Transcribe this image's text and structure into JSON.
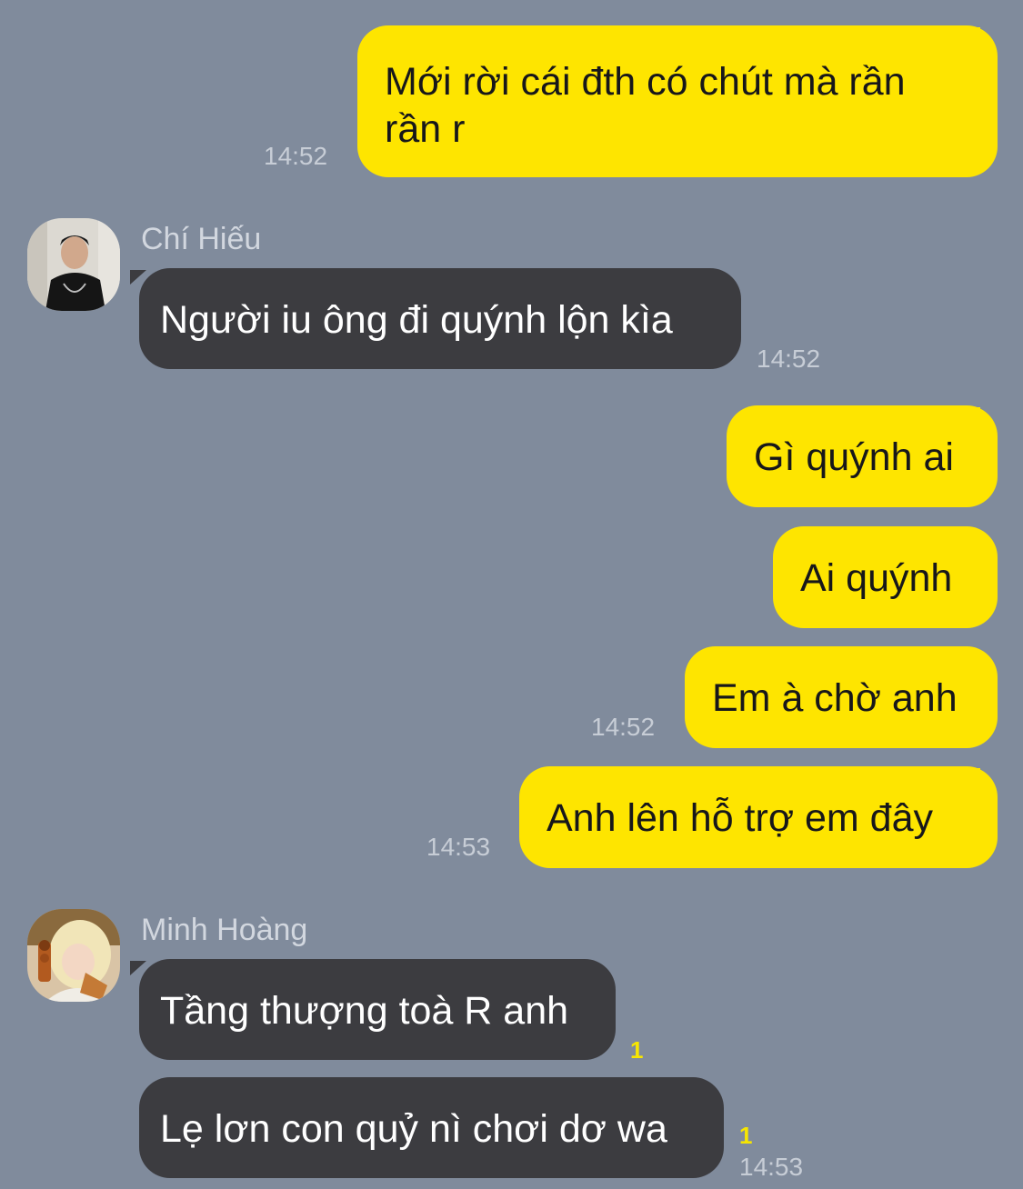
{
  "messages": [
    {
      "text": "Mới rời cái đth có chút mà rần rần r",
      "time": "14:52"
    },
    {
      "sender": "Chí Hiếu",
      "text": "Người iu ông đi quýnh lộn kìa",
      "time": "14:52"
    },
    {
      "text": "Gì quýnh ai"
    },
    {
      "text": "Ai quýnh"
    },
    {
      "text": "Em à chờ anh",
      "time": "14:52"
    },
    {
      "text": "Anh lên hỗ trợ em đây",
      "time": "14:53"
    },
    {
      "sender": "Minh Hoàng",
      "text": "Tầng thượng toà R anh",
      "unread": "1"
    },
    {
      "text": "Lẹ lơn con quỷ nì chơi dơ wa",
      "unread": "1",
      "time": "14:53"
    }
  ],
  "colors": {
    "background": "#808b9c",
    "outgoing_bubble": "#fee500",
    "incoming_bubble": "#3c3c40",
    "unread_badge": "#f7e600"
  }
}
